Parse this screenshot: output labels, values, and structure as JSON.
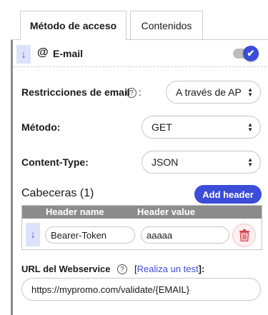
{
  "tabs": [
    {
      "label": "Método de acceso",
      "active": true
    },
    {
      "label": "Contenidos",
      "active": false
    }
  ],
  "method": {
    "handle_icon": "arrow-down-icon",
    "type_icon": "at-icon",
    "at_symbol": "@",
    "title": "E-mail",
    "enabled": true,
    "toggle_check": "✔"
  },
  "fields": {
    "restrictions": {
      "label": "Restricciones de email",
      "colon": ":",
      "value": "A través de AP"
    },
    "method": {
      "label": "Método:",
      "value": "GET"
    },
    "content_type": {
      "label": "Content-Type:",
      "value": "JSON"
    }
  },
  "headers": {
    "title": "Cabeceras (1)",
    "add_label": "Add header",
    "columns": [
      "Header name",
      "Header value"
    ],
    "rows": [
      {
        "name": "Bearer-Token",
        "value": "aaaaa"
      }
    ]
  },
  "webservice": {
    "label": "URL del Webservice",
    "link_prefix": "[",
    "link_text": "Realiza un test",
    "link_suffix": "]:",
    "url": "https://mypromo.com/validate/{EMAIL}"
  },
  "glyphs": {
    "arrow_down": "↓",
    "help": "?",
    "select_up": "▲",
    "select_down": "▼"
  },
  "colors": {
    "accent": "#3b4cd8",
    "handle_bg": "#dfe2fb",
    "table_header": "#8c8c8c",
    "delete": "#d9434f"
  }
}
